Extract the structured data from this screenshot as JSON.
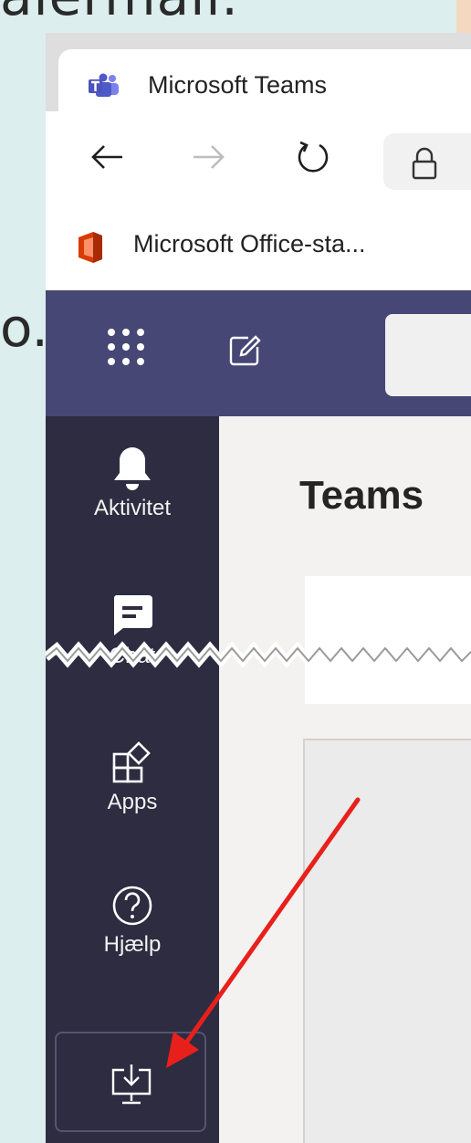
{
  "background": {
    "top_text": "alermail.",
    "side_text": "o."
  },
  "browser": {
    "tab_title": "Microsoft Teams",
    "bookmark_label": "Microsoft Office-sta..."
  },
  "teams": {
    "page_title": "Teams",
    "header_color": "#464775",
    "rail_color": "#2d2c40",
    "rail": [
      {
        "label": "Aktivitet",
        "icon": "bell-icon"
      },
      {
        "label": "Chat",
        "icon": "chat-icon"
      },
      {
        "label": "Apps",
        "icon": "apps-icon"
      },
      {
        "label": "Hjælp",
        "icon": "help-icon"
      }
    ],
    "install_icon": "download-desktop-app-icon"
  },
  "annotation": {
    "arrow_color": "#e8201c"
  }
}
